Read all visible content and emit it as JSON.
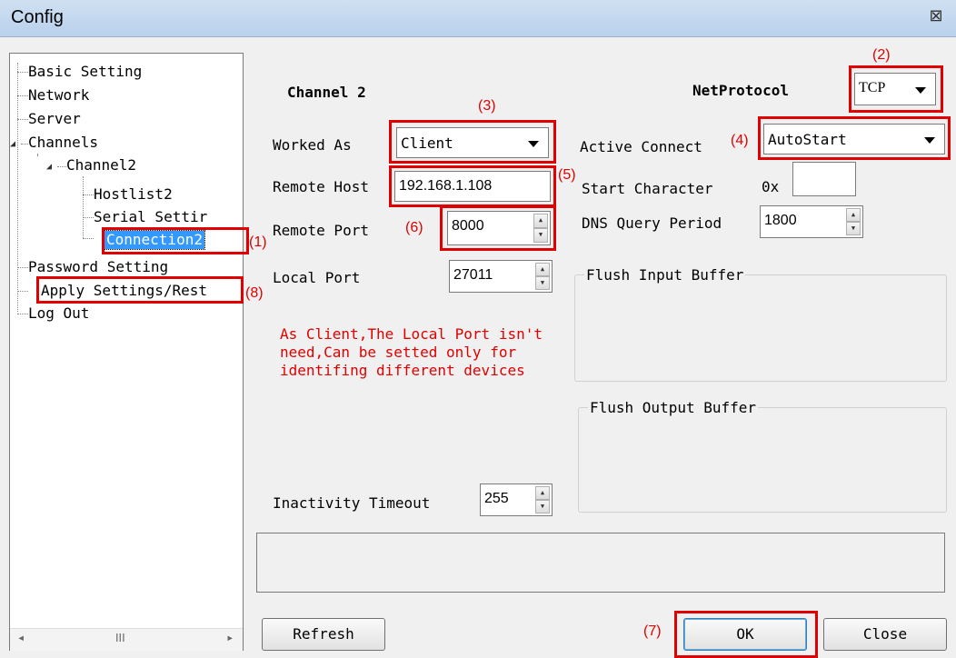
{
  "window": {
    "title": "Config",
    "close_glyph": "⊠"
  },
  "tree": {
    "items": [
      {
        "label": "Basic Setting"
      },
      {
        "label": "Network"
      },
      {
        "label": "Server"
      },
      {
        "label": "Channels"
      },
      {
        "label": "Channel2"
      },
      {
        "label": "Hostlist2"
      },
      {
        "label": "Serial Settir"
      },
      {
        "label": "Connection2",
        "selected": true
      },
      {
        "label": "Password Setting"
      },
      {
        "label": "Apply Settings/Rest"
      },
      {
        "label": "Log Out"
      }
    ],
    "scroll_left": "◂",
    "scroll_right": "▸",
    "scroll_thumb": "III"
  },
  "form": {
    "channel_title": "Channel 2",
    "net_protocol_label": "NetProtocol",
    "net_protocol_value": "TCP",
    "worked_as_label": "Worked As",
    "worked_as_value": "Client",
    "active_connect_label": "Active Connect",
    "active_connect_value": "AutoStart",
    "remote_host_label": "Remote Host",
    "remote_host_value": "192.168.1.108",
    "start_character_label": "Start Character",
    "start_character_prefix": "0x",
    "start_character_value": "",
    "remote_port_label": "Remote Port",
    "remote_port_value": "8000",
    "dns_query_label": "DNS Query Period",
    "dns_query_value": "1800",
    "local_port_label": "Local Port",
    "local_port_value": "27011",
    "flush_input_label": "Flush Input Buffer",
    "flush_output_label": "Flush Output Buffer",
    "inactivity_label": "Inactivity Timeout",
    "inactivity_value": "255",
    "note_text": "As Client,The Local Port isn't need,Can be setted only for identifing different devices"
  },
  "buttons": {
    "refresh": "Refresh",
    "ok": "OK",
    "close": "Close"
  },
  "annotations": {
    "a1": "(1)",
    "a2": "(2)",
    "a3": "(3)",
    "a4": "(4)",
    "a5": "(5)",
    "a6": "(6)",
    "a7": "(7)",
    "a8": "(8)"
  },
  "colors": {
    "annotation": "#e00000",
    "selection": "#3399ff",
    "title_bar": "#c5daf0"
  }
}
